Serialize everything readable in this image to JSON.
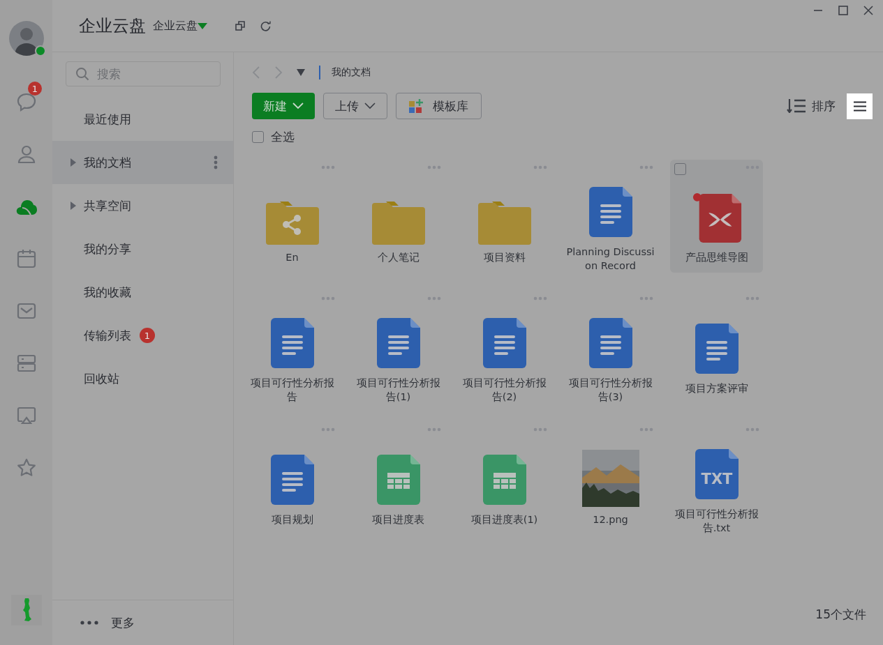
{
  "rail": {
    "avatar": {
      "online": true
    },
    "items": [
      {
        "kind": "chat",
        "selected": false,
        "badge": "1"
      },
      {
        "kind": "contacts",
        "selected": false
      },
      {
        "kind": "cloud",
        "selected": true
      },
      {
        "kind": "calendar",
        "selected": false
      },
      {
        "kind": "mail",
        "selected": false
      },
      {
        "kind": "server",
        "selected": false
      },
      {
        "kind": "screen",
        "selected": false
      },
      {
        "kind": "star",
        "selected": false
      }
    ]
  },
  "header": {
    "title": "企业云盘",
    "switcher": "企业云盘"
  },
  "sidebar": {
    "search": {
      "placeholder": "搜索"
    },
    "items": [
      {
        "label": "最近使用",
        "selected": false,
        "has_children": false
      },
      {
        "label": "我的文档",
        "selected": true,
        "has_children": true
      },
      {
        "label": "共享空间",
        "selected": false,
        "has_children": true
      },
      {
        "label": "我的分享",
        "selected": false,
        "has_children": false
      },
      {
        "label": "我的收藏",
        "selected": false,
        "has_children": false
      },
      {
        "label": "传输列表",
        "selected": false,
        "has_children": false,
        "badge": "1"
      },
      {
        "label": "回收站",
        "selected": false,
        "has_children": false
      }
    ],
    "more": "更多"
  },
  "breadcrumb": "我的文档",
  "toolbar": {
    "new": "新建",
    "upload": "上传",
    "templates": "模板库",
    "sort": "排序",
    "select_all": "全选",
    "select_all_checked": false
  },
  "files": [
    {
      "kind": "shared-folder",
      "name": "En",
      "hovered": false,
      "checked": false
    },
    {
      "kind": "folder",
      "name": "个人笔记",
      "hovered": false,
      "checked": false
    },
    {
      "kind": "folder",
      "name": "项目资料",
      "hovered": false,
      "checked": false
    },
    {
      "kind": "doc",
      "name": "Planning Discussion Record",
      "hovered": false,
      "checked": false
    },
    {
      "kind": "mindmap",
      "name": "产品思维导图",
      "hovered": true,
      "checked": false,
      "new": true
    },
    {
      "kind": "doc",
      "name": "项目可行性分析报告",
      "hovered": false,
      "checked": false
    },
    {
      "kind": "doc",
      "name": "项目可行性分析报告(1)",
      "hovered": false,
      "checked": false
    },
    {
      "kind": "doc",
      "name": "项目可行性分析报告(2)",
      "hovered": false,
      "checked": false
    },
    {
      "kind": "doc",
      "name": "项目可行性分析报告(3)",
      "hovered": false,
      "checked": false
    },
    {
      "kind": "doc",
      "name": "项目方案评审",
      "hovered": false,
      "checked": false
    },
    {
      "kind": "doc",
      "name": "项目规划",
      "hovered": false,
      "checked": false
    },
    {
      "kind": "sheet",
      "name": "项目进度表",
      "hovered": false,
      "checked": false
    },
    {
      "kind": "sheet",
      "name": "项目进度表(1)",
      "hovered": false,
      "checked": false
    },
    {
      "kind": "image",
      "name": "12.png",
      "hovered": false,
      "checked": false
    },
    {
      "kind": "txt",
      "name": "项目可行性分析报告.txt",
      "hovered": false,
      "checked": false,
      "icon_text": "TXT"
    }
  ],
  "status_bar": {
    "count": "15个文件"
  }
}
